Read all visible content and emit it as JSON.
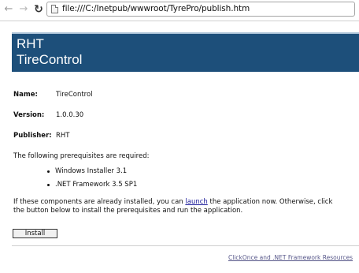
{
  "browser": {
    "nav_back_icon": "arrow-left-icon",
    "nav_forward_icon": "arrow-right-icon",
    "reload_icon": "reload-icon",
    "address": "file:///C:/Inetpub/wwwroot/TyrePro/publish.htm"
  },
  "banner": {
    "line1": "RHT",
    "line2": "TireControl",
    "background": "#1d4f7a"
  },
  "details": {
    "name_label": "Name:",
    "name_value": "TireControl",
    "version_label": "Version:",
    "version_value": "1.0.0.30",
    "publisher_label": "Publisher:",
    "publisher_value": "RHT"
  },
  "prerequisites": {
    "intro": "The following prerequisites are required:",
    "items": [
      "Windows Installer 3.1",
      ".NET Framework 3.5 SP1"
    ]
  },
  "instructions": {
    "line1_before": "If these components are already installed, you can ",
    "line1_link": "launch",
    "line1_after": " the application now. Otherwise, click",
    "line2": "the button below to install the prerequisites and run the application."
  },
  "install_button_label": "Install",
  "footer_link": "ClickOnce and .NET Framework Resources"
}
